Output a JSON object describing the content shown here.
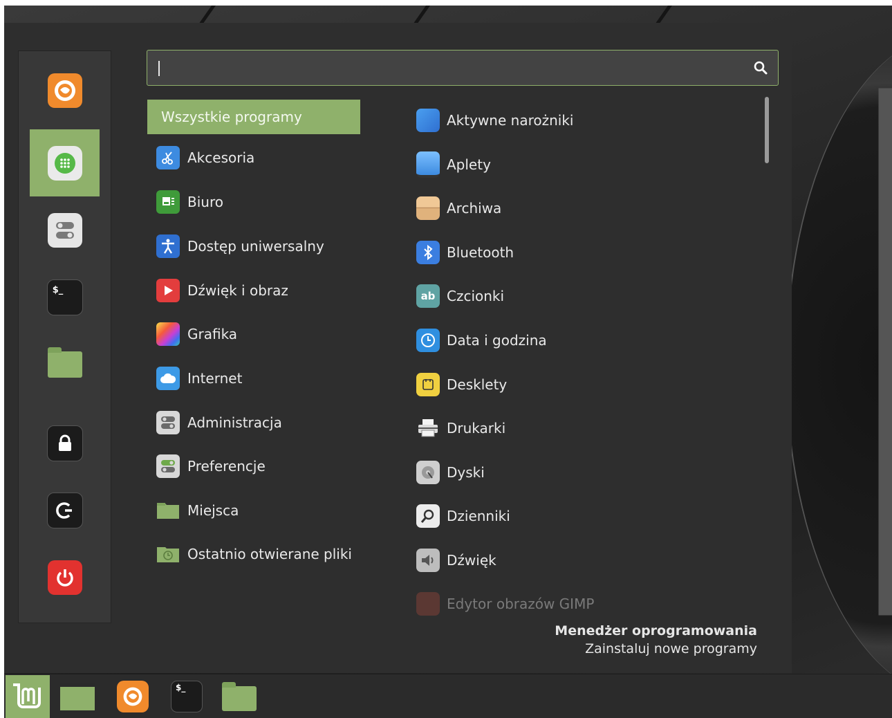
{
  "search": {
    "value": "",
    "placeholder": ""
  },
  "favorites": [
    {
      "name": "firefox",
      "icon": "firefox-icon"
    },
    {
      "name": "software-manager",
      "icon": "app-grid-icon"
    },
    {
      "name": "settings",
      "icon": "toggles-icon"
    },
    {
      "name": "terminal",
      "icon": "terminal-icon",
      "glyph": "$_"
    },
    {
      "name": "files",
      "icon": "folder-icon"
    },
    {
      "name": "lock-screen",
      "icon": "lock-icon"
    },
    {
      "name": "logout",
      "icon": "logout-icon"
    },
    {
      "name": "shutdown",
      "icon": "power-icon"
    }
  ],
  "categories": [
    {
      "label": "Wszystkie programy",
      "active": true
    },
    {
      "label": "Akcesoria",
      "icon": "scissors-icon",
      "color": "#3d8be0"
    },
    {
      "label": "Biuro",
      "icon": "presentation-icon",
      "color": "#3f9b3a"
    },
    {
      "label": "Dostęp uniwersalny",
      "icon": "accessibility-icon",
      "color": "#2f6fd0"
    },
    {
      "label": "Dźwięk i obraz",
      "icon": "play-icon",
      "color": "#e33d3d"
    },
    {
      "label": "Grafika",
      "icon": "palette-icon",
      "color": "#d94fb0"
    },
    {
      "label": "Internet",
      "icon": "cloud-icon",
      "color": "#3d9ae6"
    },
    {
      "label": "Administracja",
      "icon": "toggles-icon",
      "color": "#d8d8d8"
    },
    {
      "label": "Preferencje",
      "icon": "toggles-green-icon",
      "color": "#d8d8d8"
    },
    {
      "label": "Miejsca",
      "icon": "folder-icon",
      "color": "#8fb16b"
    },
    {
      "label": "Ostatnio otwierane pliki",
      "icon": "recent-folder-icon",
      "color": "#8fb16b"
    }
  ],
  "apps": [
    {
      "label": "Aktywne narożniki",
      "icon": "hot-corners-icon",
      "color": "#4a9ff0"
    },
    {
      "label": "Aplety",
      "icon": "applets-icon",
      "color": "#5aa8f5"
    },
    {
      "label": "Archiwa",
      "icon": "archive-icon",
      "color": "#e0b27c"
    },
    {
      "label": "Bluetooth",
      "icon": "bluetooth-icon",
      "color": "#3b7ee0"
    },
    {
      "label": "Czcionki",
      "icon": "fonts-icon",
      "color": "#5fa3a3"
    },
    {
      "label": "Data i godzina",
      "icon": "clock-icon",
      "color": "#2f8fe0"
    },
    {
      "label": "Desklety",
      "icon": "desklets-icon",
      "color": "#f0d040"
    },
    {
      "label": "Drukarki",
      "icon": "printer-icon",
      "color": "#dcdcdc"
    },
    {
      "label": "Dyski",
      "icon": "disks-icon",
      "color": "#cfcfcf"
    },
    {
      "label": "Dzienniki",
      "icon": "logs-icon",
      "color": "#ececec"
    },
    {
      "label": "Dźwięk",
      "icon": "sound-icon",
      "color": "#bdbdbd"
    },
    {
      "label": "Edytor obrazów GIMP",
      "icon": "gimp-icon",
      "color": "#b04a3c",
      "faded": true
    }
  ],
  "footer": {
    "title": "Menedżer oprogramowania",
    "subtitle": "Zainstaluj nowe programy"
  },
  "panel": {
    "items": [
      "menu-button",
      "show-desktop",
      "firefox",
      "terminal",
      "files"
    ],
    "terminal_glyph": "$_"
  },
  "colors": {
    "accent": "#8fb16b",
    "menu_bg": "#2e2e2e",
    "favbar_bg": "#383838",
    "panel_bg": "#2b2b2b"
  }
}
